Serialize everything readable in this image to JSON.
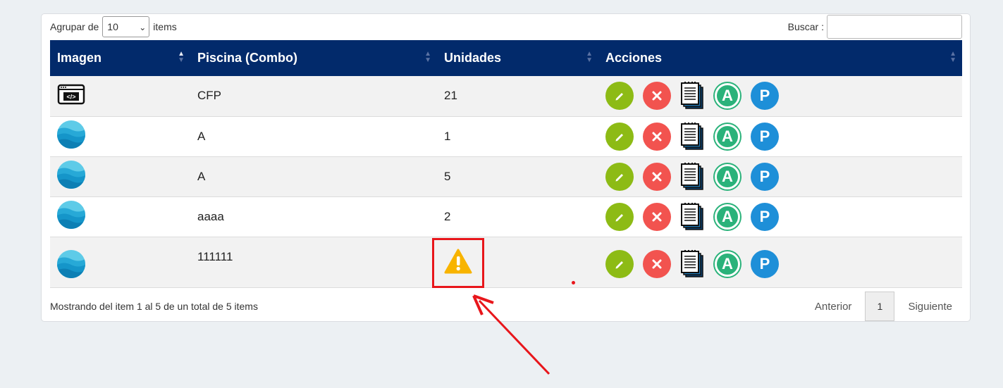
{
  "toolbar": {
    "group_label": "Agrupar de",
    "page_size": "10",
    "items_label": "items",
    "search_label": "Buscar :",
    "search_value": ""
  },
  "table": {
    "headers": [
      "Imagen",
      "Piscina (Combo)",
      "Unidades",
      "Acciones"
    ],
    "rows": [
      {
        "image": "code-window-icon",
        "piscina": "CFP",
        "unidades": "21"
      },
      {
        "image": "pool-water-icon",
        "piscina": "A",
        "unidades": "1"
      },
      {
        "image": "pool-water-icon",
        "piscina": "A",
        "unidades": "5"
      },
      {
        "image": "pool-water-icon",
        "piscina": "aaaa",
        "unidades": "2"
      },
      {
        "image": "pool-water-icon",
        "piscina": "111111",
        "unidades": "",
        "unidades_icon": "warning-icon"
      }
    ],
    "action_icons": [
      "edit-icon",
      "delete-icon",
      "documents-icon",
      "a-icon",
      "p-icon"
    ],
    "a_letter": "A",
    "p_letter": "P"
  },
  "footer": {
    "summary": "Mostrando del item 1 al 5 de un total de 5 items",
    "prev": "Anterior",
    "page": "1",
    "next": "Siguiente"
  },
  "colors": {
    "header_bg": "#022a6b",
    "edit": "#8dbb15",
    "delete": "#f2534f",
    "a_button": "#2ab27a",
    "p_button": "#1e8fd8",
    "annotation": "#e8161b",
    "warning": "#f8b400"
  }
}
